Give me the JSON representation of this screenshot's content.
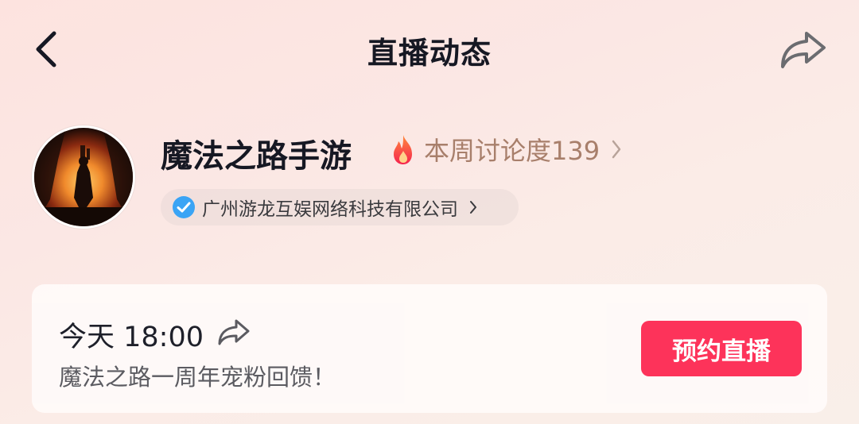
{
  "header": {
    "title": "直播动态",
    "back_icon": "chevron-left-icon",
    "share_icon": "share-arrow-icon"
  },
  "account": {
    "name": "魔法之路手游",
    "hot_icon": "fire-icon",
    "hot_text": "本周讨论度139",
    "company_icon": "verified-badge-icon",
    "company": "广州游龙互娱网络科技有限公司"
  },
  "event": {
    "time": "今天 18:00",
    "share_icon": "share-arrow-icon",
    "title": "魔法之路一周年宠粉回馈！",
    "button_label": "预约直播"
  },
  "colors": {
    "accent": "#fe2c55",
    "verified": "#3aa4f5",
    "hot_text": "#a87f6b"
  }
}
